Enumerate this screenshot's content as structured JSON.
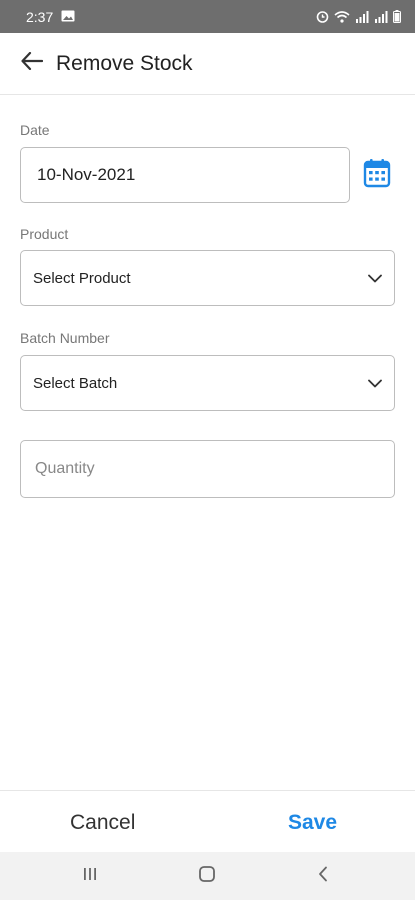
{
  "status_bar": {
    "time": "2:37",
    "icons": [
      "image-icon",
      "alarm-icon",
      "wifi-icon",
      "signal-icon",
      "signal-icon",
      "battery-icon"
    ]
  },
  "app_bar": {
    "title": "Remove Stock",
    "back_icon": "arrow-left-icon"
  },
  "form": {
    "date": {
      "label": "Date",
      "value": "10-Nov-2021",
      "icon": "calendar-icon"
    },
    "product": {
      "label": "Product",
      "value": "Select Product",
      "icon": "chevron-down-icon"
    },
    "batch": {
      "label": "Batch Number",
      "value": "Select Batch",
      "icon": "chevron-down-icon"
    },
    "quantity": {
      "placeholder": "Quantity",
      "value": ""
    }
  },
  "actions": {
    "cancel_label": "Cancel",
    "save_label": "Save"
  },
  "colors": {
    "accent": "#1e88e5",
    "status_bar": "#6e6e6e",
    "nav_bar": "#f2f2f2"
  },
  "nav_bar": {
    "icons": [
      "recents-icon",
      "home-icon",
      "back-nav-icon"
    ]
  }
}
